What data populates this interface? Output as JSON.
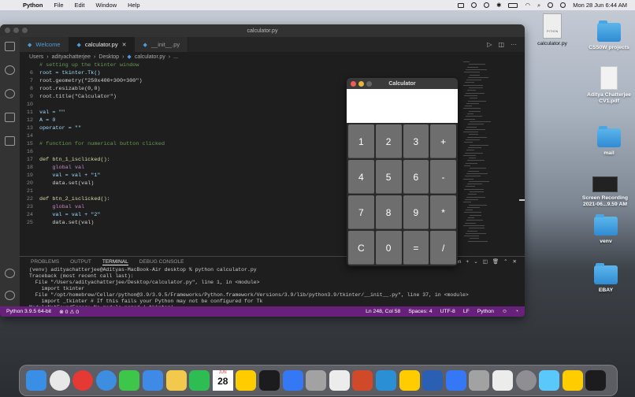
{
  "menubar": {
    "app_name": "Python",
    "items": [
      "File",
      "Edit",
      "Window",
      "Help"
    ],
    "clock": "Mon 28 Jun  6:44 AM"
  },
  "vscode": {
    "window_title": "calculator.py",
    "tabs": [
      {
        "label": "Welcome",
        "icon": "vscode-logo-icon"
      },
      {
        "label": "calculator.py",
        "icon": "python-file-icon",
        "active": true
      },
      {
        "label": "__init__.py",
        "icon": "python-file-icon"
      }
    ],
    "breadcrumb": [
      "Users",
      "adityachatterjee",
      "Desktop",
      "calculator.py",
      "..."
    ],
    "code_lines": [
      {
        "n": "",
        "text": "# setting up the tkinter window"
      },
      {
        "n": "6",
        "text": "root = tkinter.Tk()"
      },
      {
        "n": "7",
        "text": "root.geometry(\"250x400+300+300\")"
      },
      {
        "n": "8",
        "text": "root.resizable(0,0)"
      },
      {
        "n": "9",
        "text": "root.title(\"Calculator\")"
      },
      {
        "n": "10",
        "text": ""
      },
      {
        "n": "11",
        "text": "val = \"\""
      },
      {
        "n": "12",
        "text": "A = 0"
      },
      {
        "n": "13",
        "text": "operator = \"\""
      },
      {
        "n": "14",
        "text": ""
      },
      {
        "n": "15",
        "text": "# function for numerical button clicked"
      },
      {
        "n": "16",
        "text": ""
      },
      {
        "n": "17",
        "text": "def btn_1_isclicked():"
      },
      {
        "n": "18",
        "text": "    global val"
      },
      {
        "n": "19",
        "text": "    val = val + \"1\""
      },
      {
        "n": "20",
        "text": "    data.set(val)"
      },
      {
        "n": "21",
        "text": ""
      },
      {
        "n": "22",
        "text": "def btn_2_isclicked():"
      },
      {
        "n": "23",
        "text": "    global val"
      },
      {
        "n": "24",
        "text": "    val = val + \"2\""
      },
      {
        "n": "25",
        "text": "    data.set(val)"
      }
    ],
    "panel_tabs": [
      "PROBLEMS",
      "OUTPUT",
      "TERMINAL",
      "DEBUG CONSOLE"
    ],
    "panel_active": "TERMINAL",
    "terminal_selector": "Python",
    "terminal_lines": [
      "(venv) adityachatterjee@Adityas-MacBook-Air desktop % python calculator.py",
      "Traceback (most recent call last):",
      "  File \"/Users/adityachatterjee/Desktop/calculator.py\", line 1, in <module>",
      "    import tkinter",
      "  File \"/opt/homebrew/Cellar/python@3.9/3.9.5/Frameworks/Python.framework/Versions/3.9/lib/python3.9/tkinter/__init__.py\", line 37, in <module>",
      "    import _tkinter # If this fails your Python may not be configured for Tk",
      "ModuleNotFoundError: No module named '_tkinter'",
      "(venv) adityachatterjee@Adityas-MacBook-Air desktop % python calculator.py",
      "(venv) adityachatterjee@Adityas-MacBook-Air desktop % python calculator.py"
    ],
    "status": {
      "interpreter": "Python 3.9.5 64-bit",
      "problems": "⊗ 0 ⚠ 0",
      "position": "Ln 248, Col 58",
      "spaces": "Spaces: 4",
      "encoding": "UTF-8",
      "eol": "LF",
      "language": "Python"
    }
  },
  "calculator": {
    "title": "Calculator",
    "keys": [
      "1",
      "2",
      "3",
      "+",
      "4",
      "5",
      "6",
      "-",
      "7",
      "8",
      "9",
      "*",
      "C",
      "0",
      "=",
      "/"
    ]
  },
  "desktop": {
    "items": [
      {
        "label": "calculator.py",
        "kind": "python-file-icon"
      },
      {
        "label": "CS50W projects",
        "kind": "folder-icon"
      },
      {
        "label": "Aditya Chatterjee CV1.pdf",
        "kind": "pdf-icon"
      },
      {
        "label": "mail",
        "kind": "folder-icon"
      },
      {
        "label": "Screen Recording 2021-06...9.59 AM",
        "kind": "video-icon"
      },
      {
        "label": "venv",
        "kind": "folder-icon"
      },
      {
        "label": "EBAY",
        "kind": "folder-icon"
      }
    ]
  },
  "dock": {
    "calendar_month": "JUN",
    "calendar_day": "28",
    "apps": [
      "finder",
      "chrome",
      "youtube",
      "safari",
      "messages",
      "mail",
      "photos",
      "facetime",
      "calendar",
      "reminders",
      "notes",
      "tv",
      "app-store",
      "system-preferences",
      "powerpoint",
      "vscode",
      "preview",
      "word",
      "textedit",
      "stickies",
      "image-capture",
      "quicktime",
      "terminal",
      "launchpad",
      "trash"
    ],
    "colors": {
      "finder": "#3a8ee6",
      "chrome": "#e8e8e8",
      "youtube": "#e53935",
      "safari": "#3d8de0",
      "messages": "#3ec64a",
      "mail": "#3e8ae6",
      "photos": "#f2c94c",
      "facetime": "#2ebd52",
      "word": "#2b5fb4",
      "powerpoint": "#d04a2a",
      "vscode": "#2b8fd6"
    }
  }
}
